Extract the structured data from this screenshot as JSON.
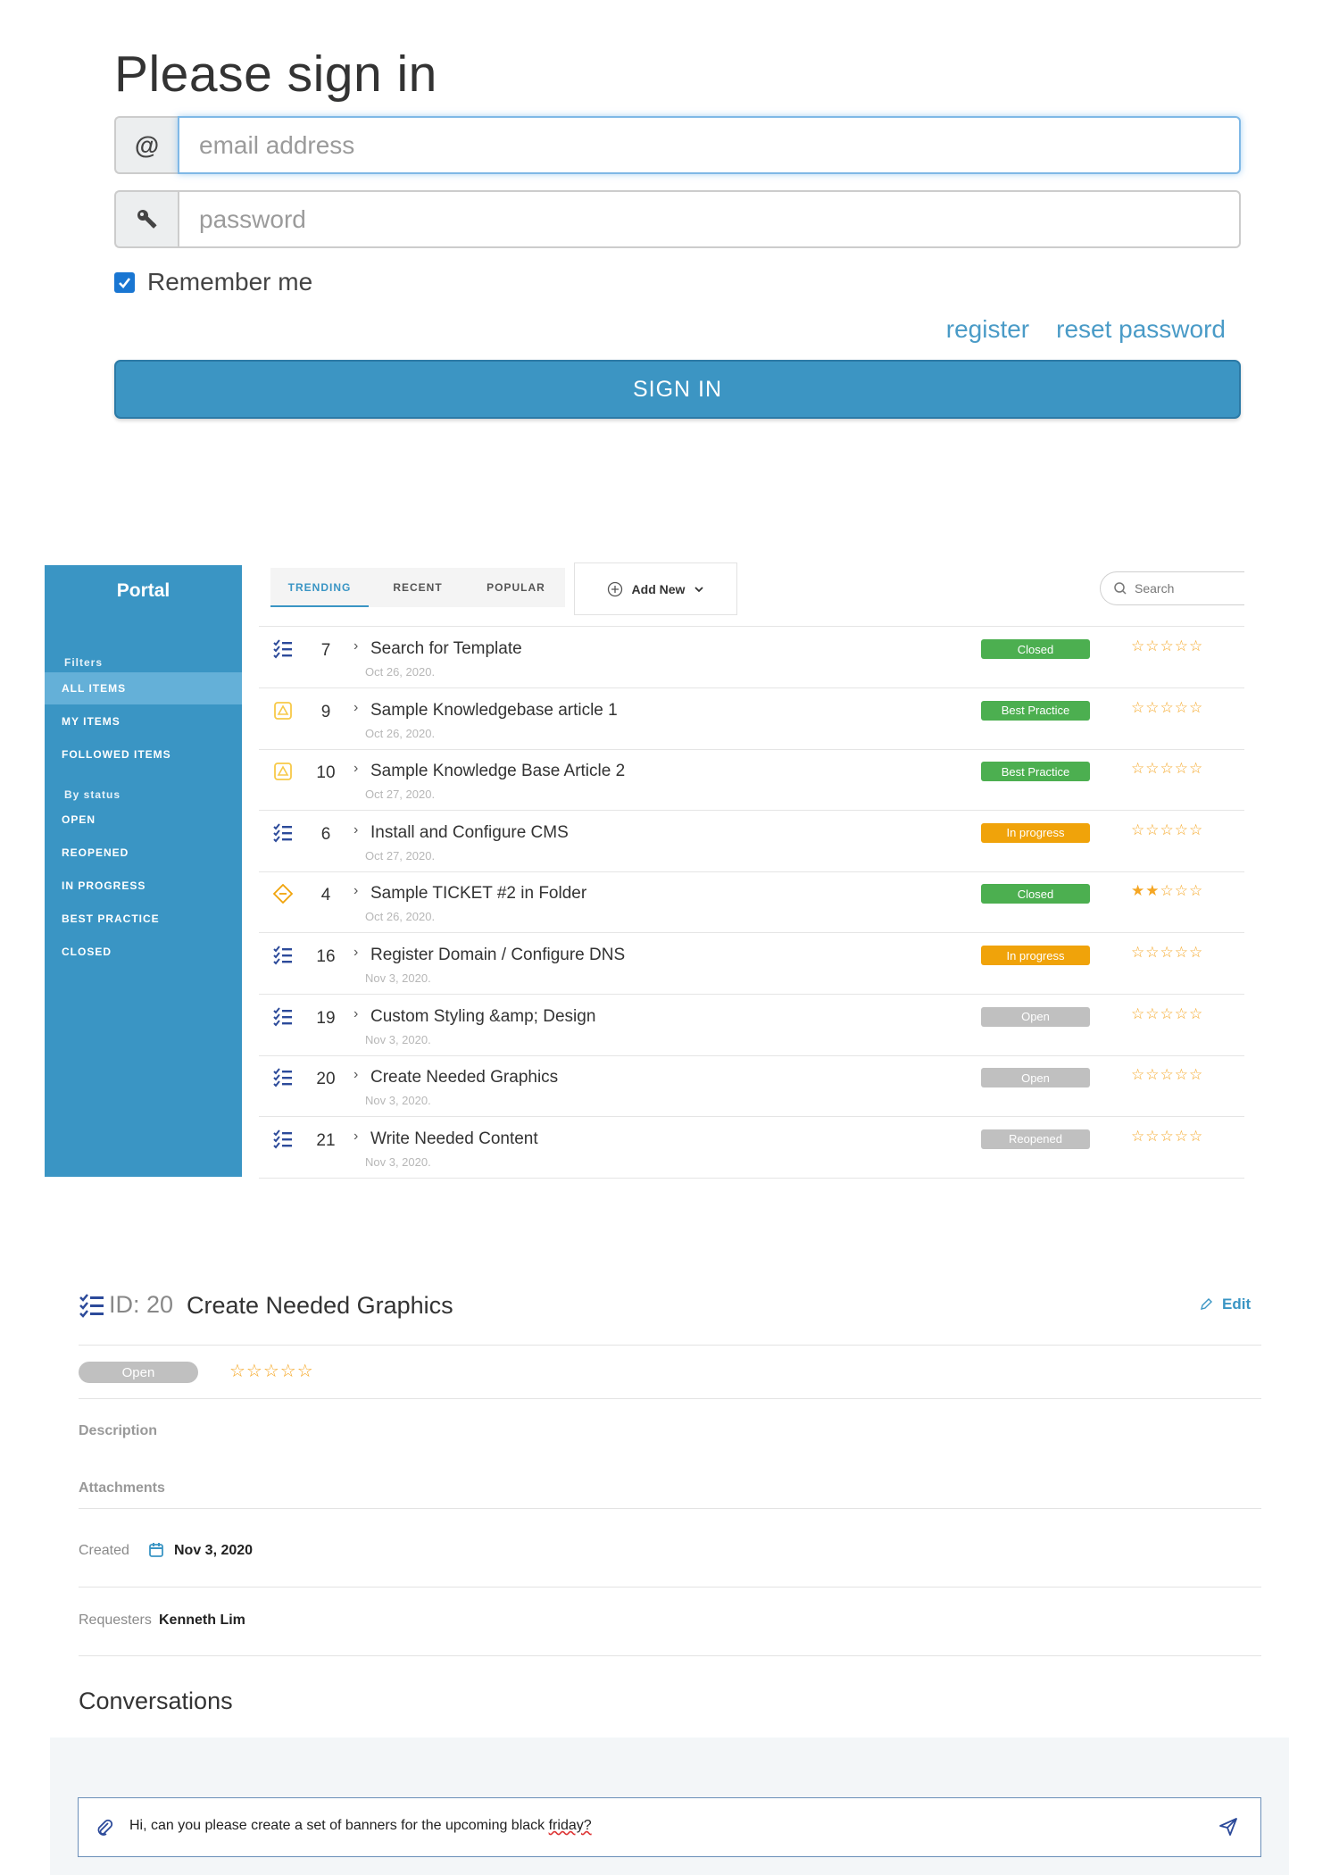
{
  "signin": {
    "title": "Please sign in",
    "email_icon": "@",
    "email_placeholder": "email address",
    "password_icon": "key-icon",
    "password_placeholder": "password",
    "remember_label": "Remember me",
    "remember_checked": true,
    "register_link": "register",
    "reset_link": "reset password",
    "submit_label": "SIGN IN"
  },
  "portal": {
    "brand": "Portal",
    "filters_label": "Filters",
    "filters": [
      "ALL ITEMS",
      "MY ITEMS",
      "FOLLOWED ITEMS"
    ],
    "status_label": "By status",
    "statuses": [
      "OPEN",
      "REOPENED",
      "IN PROGRESS",
      "BEST PRACTICE",
      "CLOSED"
    ],
    "tabs": [
      "TRENDING",
      "RECENT",
      "POPULAR"
    ],
    "add_new_label": "Add New",
    "search_placeholder": "Search",
    "tickets": [
      {
        "icon": "checklist-icon",
        "id": "7",
        "title": "Search for Template",
        "date": "Oct 26, 2020.",
        "status": "Closed",
        "stars": "☆☆☆☆☆",
        "rating": 0
      },
      {
        "icon": "warning-icon",
        "id": "9",
        "title": "Sample Knowledgebase article 1",
        "date": "Oct 26, 2020.",
        "status": "Best Practice",
        "stars": "☆☆☆☆☆",
        "rating": 0
      },
      {
        "icon": "warning-icon",
        "id": "10",
        "title": "Sample Knowledge Base Article 2",
        "date": "Oct 27, 2020.",
        "status": "Best Practice",
        "stars": "☆☆☆☆☆",
        "rating": 0
      },
      {
        "icon": "checklist-icon",
        "id": "6",
        "title": "Install and Configure CMS",
        "date": "Oct 27, 2020.",
        "status": "In progress",
        "stars": "☆☆☆☆☆",
        "rating": 0
      },
      {
        "icon": "ticket-icon",
        "id": "4",
        "title": "Sample TICKET #2 in Folder",
        "date": "Oct 26, 2020.",
        "status": "Closed",
        "stars": "★★☆☆☆",
        "rating": 2
      },
      {
        "icon": "checklist-icon",
        "id": "16",
        "title": "Register Domain / Configure DNS",
        "date": "Nov 3, 2020.",
        "status": "In progress",
        "stars": "☆☆☆☆☆",
        "rating": 0
      },
      {
        "icon": "checklist-icon",
        "id": "19",
        "title": "Custom Styling &amp; Design",
        "date": "Nov 3, 2020.",
        "status": "Open",
        "stars": "☆☆☆☆☆",
        "rating": 0
      },
      {
        "icon": "checklist-icon",
        "id": "20",
        "title": "Create Needed Graphics",
        "date": "Nov 3, 2020.",
        "status": "Open",
        "stars": "☆☆☆☆☆",
        "rating": 0
      },
      {
        "icon": "checklist-icon",
        "id": "21",
        "title": "Write Needed Content",
        "date": "Nov 3, 2020.",
        "status": "Reopened",
        "stars": "☆☆☆☆☆",
        "rating": 0
      }
    ],
    "status_colors": {
      "Closed": "#4caf50",
      "Best Practice": "#4caf50",
      "In progress": "#f0a30a",
      "Open": "#c0c0c0",
      "Reopened": "#c0c0c0"
    }
  },
  "detail": {
    "id_label": "ID: 20",
    "title": "Create Needed Graphics",
    "edit_label": "Edit",
    "status": "Open",
    "stars": "☆☆☆☆☆",
    "rating": 0,
    "description_label": "Description",
    "attachments_label": "Attachments",
    "created_label": "Created",
    "created_value": "Nov 3, 2020",
    "requesters_label": "Requesters",
    "requesters_value": "Kenneth Lim",
    "conversations_title": "Conversations",
    "message_text": "Hi, can you please create a set of banners for the upcoming black ",
    "message_misspelled": "friday?"
  },
  "colors": {
    "accent": "#3a95c4",
    "sidebar": "#3a95c4",
    "star": "#f5a623"
  }
}
